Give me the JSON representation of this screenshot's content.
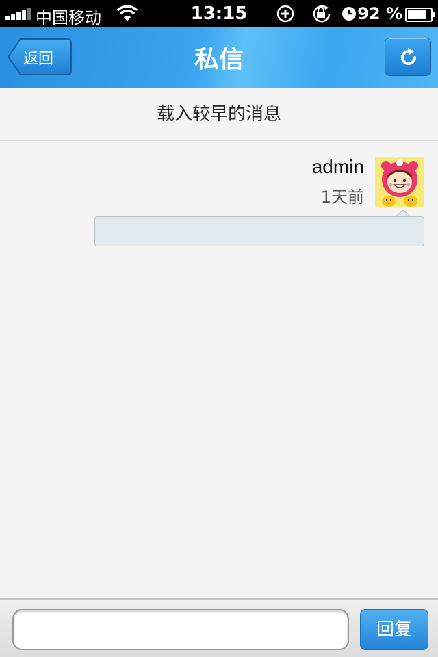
{
  "status_bar": {
    "carrier": "中国移动",
    "time": "13:15",
    "battery_percent": "92 %",
    "battery_level": 0.92,
    "icons": [
      "signal-icon",
      "wifi-icon",
      "add-icon",
      "rotation-lock-icon",
      "alarm-icon",
      "battery-icon"
    ]
  },
  "nav": {
    "back_label": "返回",
    "title": "私信",
    "refresh_icon": "refresh-icon"
  },
  "load_earlier": "载入较早的消息",
  "messages": [
    {
      "sender": "admin",
      "time": "1天前",
      "text": "",
      "avatar": "cartoon-avatar"
    }
  ],
  "reply": {
    "input_value": "",
    "button_label": "回复"
  },
  "colors": {
    "nav_blue": "#3aa4ef",
    "bubble_bg": "#dfe9ef",
    "button_blue": "#2485d8"
  }
}
